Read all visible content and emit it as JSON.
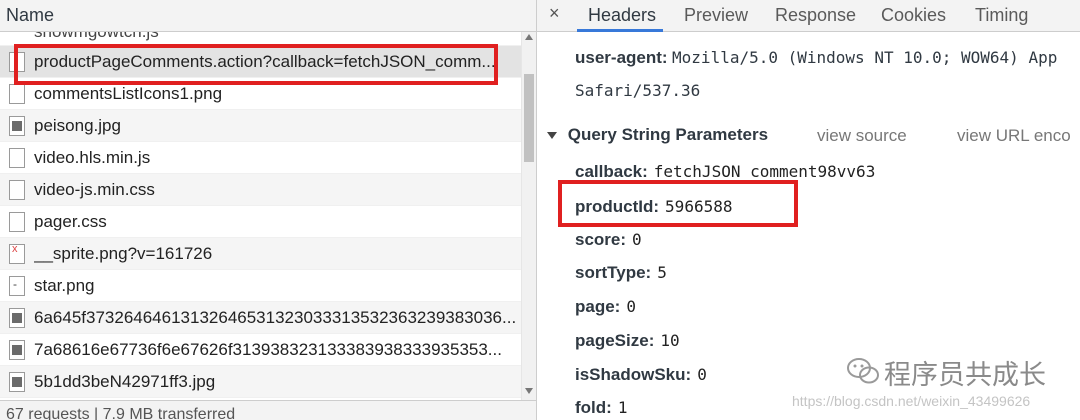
{
  "left": {
    "header": "Name",
    "partial_top": "showmgowtch.js",
    "requests": [
      {
        "name": "productPageComments.action?callback=fetchJSON_comm...",
        "icon": "file-icon",
        "type": "file"
      },
      {
        "name": "commentsListIcons1.png",
        "icon": "file-icon",
        "type": "file"
      },
      {
        "name": "peisong.jpg",
        "icon": "image-icon",
        "type": "img"
      },
      {
        "name": "video.hls.min.js",
        "icon": "file-icon",
        "type": "file"
      },
      {
        "name": "video-js.min.css",
        "icon": "file-icon",
        "type": "file"
      },
      {
        "name": "pager.css",
        "icon": "file-icon",
        "type": "file"
      },
      {
        "name": "__sprite.png?v=161726",
        "icon": "sprite-icon",
        "type": "sprite"
      },
      {
        "name": "star.png",
        "icon": "star-file-icon",
        "type": "star"
      },
      {
        "name": "6a645f37326464613132646531323033313532363239383036...",
        "icon": "image-icon",
        "type": "img"
      },
      {
        "name": "7a68616e67736f6e67626f313938323133383938333935353...",
        "icon": "image-icon",
        "type": "img"
      },
      {
        "name": "5b1dd3beN42971ff3.jpg",
        "icon": "image-icon",
        "type": "img"
      }
    ],
    "status": "67 requests | 7.9 MB transferred"
  },
  "right": {
    "tabs": [
      "Headers",
      "Preview",
      "Response",
      "Cookies",
      "Timing"
    ],
    "active_tab": "Headers",
    "close_symbol": "×",
    "user_agent_key": "user-agent:",
    "user_agent_value": "Mozilla/5.0 (Windows NT 10.0; WOW64) App",
    "user_agent_cont": "Safari/537.36",
    "section_title": "Query String Parameters",
    "view_source": "view source",
    "view_url_encoded": "view URL enco",
    "params": [
      {
        "key": "callback:",
        "value": "fetchJSON_comment98vv63"
      },
      {
        "key": "productId:",
        "value": "5966588"
      },
      {
        "key": "score:",
        "value": "0"
      },
      {
        "key": "sortType:",
        "value": "5"
      },
      {
        "key": "page:",
        "value": "0"
      },
      {
        "key": "pageSize:",
        "value": "10"
      },
      {
        "key": "isShadowSku:",
        "value": "0"
      },
      {
        "key": "fold:",
        "value": "1"
      }
    ]
  },
  "watermark": {
    "text": "程序员共成长",
    "url": "https://blog.csdn.net/weixin_43499626"
  },
  "colors": {
    "highlight_red": "#e02020",
    "tab_active_underline": "#3879d9",
    "panel_bg": "#f3f3f3"
  }
}
